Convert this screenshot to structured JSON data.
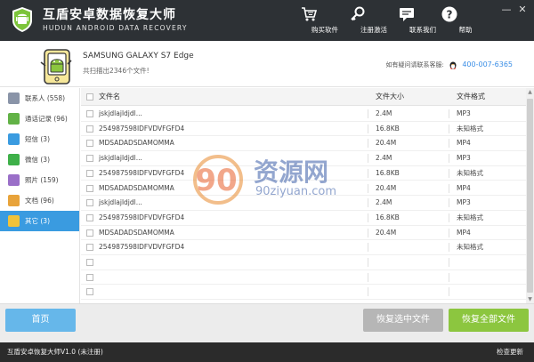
{
  "app": {
    "title": "互盾安卓数据恢复大师",
    "subtitle": "HUDUN ANDROID DATA RECOVERY"
  },
  "toolbar": [
    {
      "label": "购买软件",
      "icon": "cart-icon"
    },
    {
      "label": "注册激活",
      "icon": "key-icon"
    },
    {
      "label": "联系我们",
      "icon": "chat-icon"
    },
    {
      "label": "帮助",
      "icon": "help-icon"
    }
  ],
  "device": {
    "name": "SAMSUNG  GALAXY S7 Edge",
    "scan_text": "共扫描出2346个文件!"
  },
  "contact": {
    "label": "如有疑问请联系客服:",
    "phone": "400-007-6365"
  },
  "sidebar": [
    {
      "label": "联系人  (558)",
      "color": "#8a94a8"
    },
    {
      "label": "通话记录  (96)",
      "color": "#62b246"
    },
    {
      "label": "短信  (3)",
      "color": "#3a9be0"
    },
    {
      "label": "微信  (3)",
      "color": "#3eb049"
    },
    {
      "label": "照片  (159)",
      "color": "#9a6fc8"
    },
    {
      "label": "文档  (96)",
      "color": "#e8a33a"
    },
    {
      "label": "其它  (3)",
      "color": "#f0c23a",
      "active": true
    }
  ],
  "table": {
    "headers": {
      "name": "文件名",
      "size": "文件大小",
      "format": "文件格式"
    },
    "rows": [
      {
        "name": "jskjdlajldjdl...",
        "size": "2.4M",
        "format": "MP3"
      },
      {
        "name": "254987598IDFVDVFGFD4",
        "size": "16.8KB",
        "format": "未知格式"
      },
      {
        "name": "MDSADADSDAMOMMA",
        "size": "20.4M",
        "format": "MP4"
      },
      {
        "name": "jskjdlajldjdl...",
        "size": "2.4M",
        "format": "MP3"
      },
      {
        "name": "254987598IDFVDVFGFD4",
        "size": "16.8KB",
        "format": "未知格式"
      },
      {
        "name": "MDSADADSDAMOMMA",
        "size": "20.4M",
        "format": "MP4"
      },
      {
        "name": "jskjdlajldjdl...",
        "size": "2.4M",
        "format": "MP3"
      },
      {
        "name": "254987598IDFVDVFGFD4",
        "size": "16.8KB",
        "format": "未知格式"
      },
      {
        "name": "MDSADADSDAMOMMA",
        "size": "20.4M",
        "format": "MP4"
      },
      {
        "name": "254987598IDFVDVFGFD4",
        "size": "",
        "format": "未知格式"
      },
      {
        "name": "",
        "size": "",
        "format": ""
      },
      {
        "name": "",
        "size": "",
        "format": ""
      },
      {
        "name": "",
        "size": "",
        "format": ""
      }
    ]
  },
  "watermark": {
    "text": "资源网",
    "url": "90ziyuan.com",
    "logo_text": "90"
  },
  "buttons": {
    "home": "首页",
    "recover_selected": "恢复选中文件",
    "recover_all": "恢复全部文件"
  },
  "status": {
    "version": "互盾安卓恢复大师V1.0  (未注册)",
    "update": "检查更新"
  }
}
